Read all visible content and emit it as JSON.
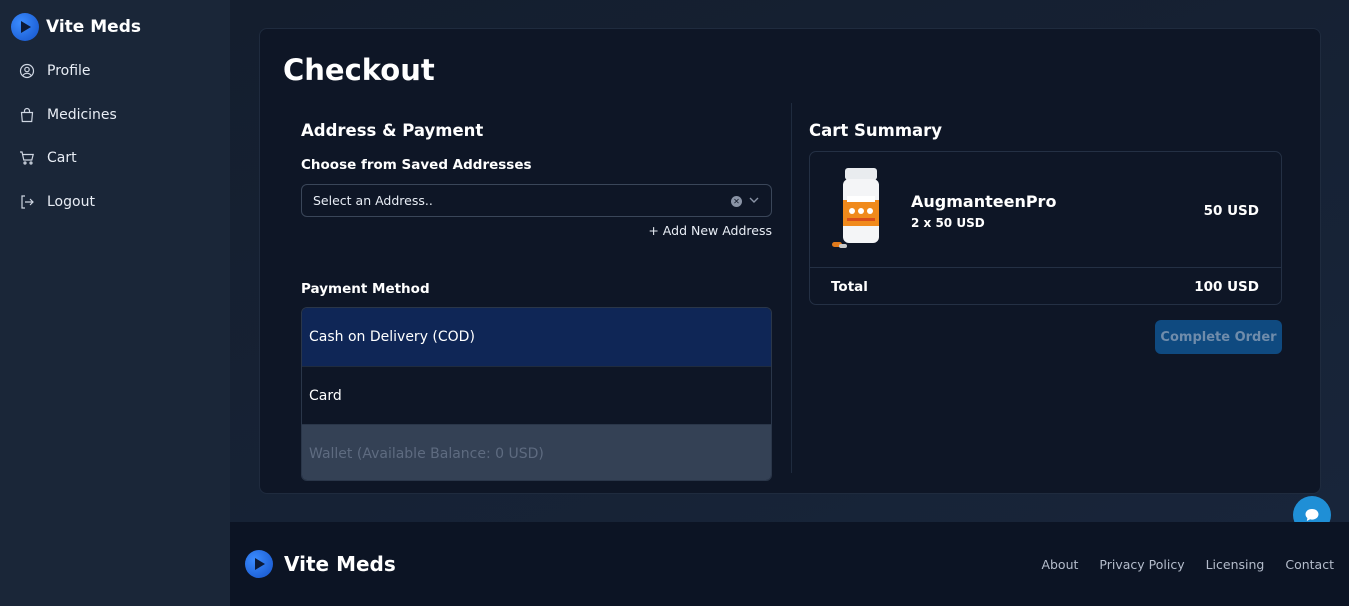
{
  "brand": {
    "name": "Vite Meds"
  },
  "sidebar": {
    "items": [
      {
        "label": "Profile",
        "icon": "user-circle-icon"
      },
      {
        "label": "Medicines",
        "icon": "shopping-bag-icon"
      },
      {
        "label": "Cart",
        "icon": "cart-icon"
      },
      {
        "label": "Logout",
        "icon": "logout-icon"
      }
    ]
  },
  "checkout": {
    "title": "Checkout",
    "address_payment": {
      "heading": "Address & Payment",
      "saved_label": "Choose from Saved Addresses",
      "select_placeholder": "Select an Address..",
      "add_new": "+ Add New Address",
      "payment_label": "Payment Method",
      "payment_options": [
        {
          "label": "Cash on Delivery (COD)",
          "state": "selected"
        },
        {
          "label": "Card",
          "state": "normal"
        },
        {
          "label": "Wallet (Available Balance: 0 USD)",
          "state": "disabled"
        }
      ]
    },
    "cart_summary": {
      "heading": "Cart Summary",
      "item": {
        "name": "AugmanteenPro",
        "qty": "2 x 50 USD",
        "price": "50 USD"
      },
      "total_label": "Total",
      "total_value": "100 USD",
      "complete_button": "Complete Order"
    }
  },
  "footer": {
    "brand": "Vite Meds",
    "links": [
      "About",
      "Privacy Policy",
      "Licensing",
      "Contact"
    ]
  },
  "colors": {
    "accent": "#1f8fd6",
    "selected_option": "#0f2656",
    "button": "#0f4a80"
  }
}
